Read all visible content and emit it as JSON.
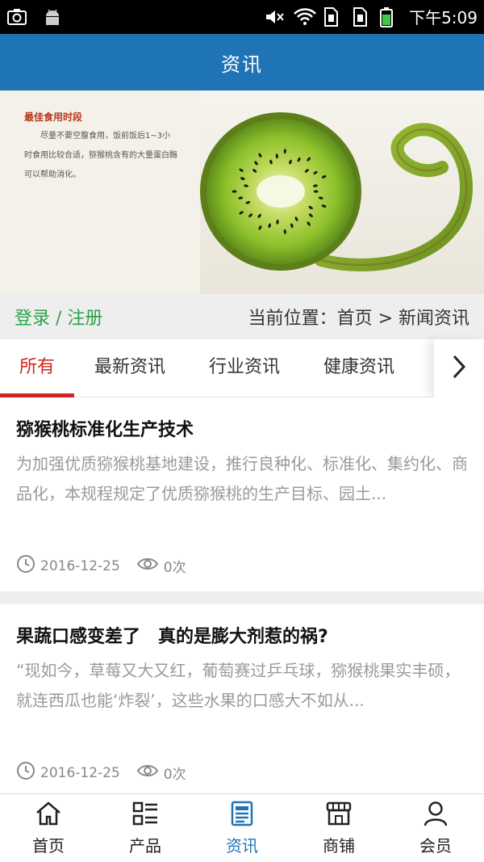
{
  "statusbar": {
    "time": "下午5:09",
    "icons": [
      "screenshot-icon",
      "android-icon",
      "mute-icon",
      "wifi-icon",
      "sim1-icon",
      "sim2-icon",
      "battery-icon"
    ]
  },
  "header": {
    "title": "资讯"
  },
  "banner": {
    "title": "最佳食用时段",
    "body": "尽量不要空腹食用，饭前饭后1~3小时食用比较合适，猕猴桃含有的大量蛋白酶可以帮助消化。"
  },
  "location": {
    "login_label": "登录 / 注册",
    "breadcrumb": "当前位置：首页 > 新闻资讯"
  },
  "tabs": [
    {
      "label": "所有",
      "active": true
    },
    {
      "label": "最新资讯",
      "active": false
    },
    {
      "label": "行业资讯",
      "active": false
    },
    {
      "label": "健康资讯",
      "active": false
    }
  ],
  "articles": [
    {
      "title": "猕猴桃标准化生产技术",
      "summary": "为加强优质猕猴桃基地建设，推行良种化、标准化、集约化、商品化，本规程规定了优质猕猴桃的生产目标、园土...",
      "date": "2016-12-25",
      "views": "0次"
    },
    {
      "title": "果蔬口感变差了　真的是膨大剂惹的祸?",
      "summary": "“现如今，草莓又大又红，葡萄赛过乒乓球，猕猴桃果实丰硕，就连西瓜也能‘炸裂’，这些水果的口感大不如从...",
      "date": "2016-12-25",
      "views": "0次"
    }
  ],
  "bottom_nav": [
    {
      "label": "首页",
      "icon": "home-icon",
      "active": false
    },
    {
      "label": "产品",
      "icon": "product-list-icon",
      "active": false
    },
    {
      "label": "资讯",
      "icon": "news-icon",
      "active": true
    },
    {
      "label": "商铺",
      "icon": "shop-icon",
      "active": false
    },
    {
      "label": "会员",
      "icon": "member-icon",
      "active": false
    }
  ],
  "colors": {
    "primary": "#1f74b5",
    "tab_active": "#d0261f",
    "login_green": "#2da24a"
  }
}
